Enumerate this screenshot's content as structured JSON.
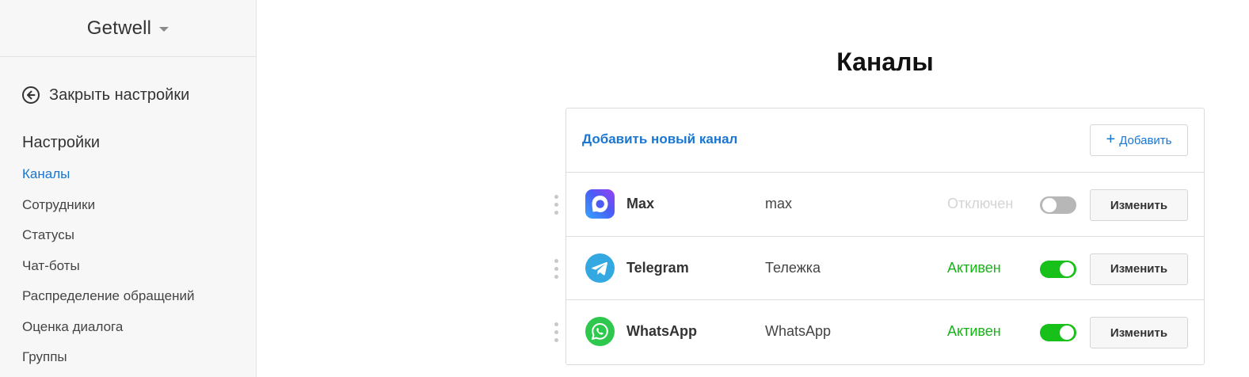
{
  "sidebar": {
    "brand": "Getwell",
    "close_settings": "Закрыть настройки",
    "heading": "Настройки",
    "items": [
      {
        "label": "Каналы"
      },
      {
        "label": "Сотрудники"
      },
      {
        "label": "Статусы"
      },
      {
        "label": "Чат-боты"
      },
      {
        "label": "Распределение обращений"
      },
      {
        "label": "Оценка диалога"
      },
      {
        "label": "Группы"
      }
    ],
    "active_item": "Каналы"
  },
  "main": {
    "title": "Каналы",
    "add_channel_label": "Добавить новый канал",
    "add_button_label": "Добавить",
    "channels": [
      {
        "icon": "max-icon",
        "name": "Max",
        "alias": "max",
        "status": "Отключен",
        "status_color": "#d4d4d4",
        "enabled": false,
        "edit_label": "Изменить"
      },
      {
        "icon": "telegram-icon",
        "name": "Telegram",
        "alias": "Тележка",
        "status": "Активен",
        "status_color": "#18b318",
        "enabled": true,
        "edit_label": "Изменить"
      },
      {
        "icon": "whatsapp-icon",
        "name": "WhatsApp",
        "alias": "WhatsApp",
        "status": "Активен",
        "status_color": "#18b318",
        "enabled": true,
        "edit_label": "Изменить"
      }
    ]
  },
  "colors": {
    "accent": "#1976d2",
    "active": "#18c01a",
    "inactive": "#b7b7b7"
  }
}
